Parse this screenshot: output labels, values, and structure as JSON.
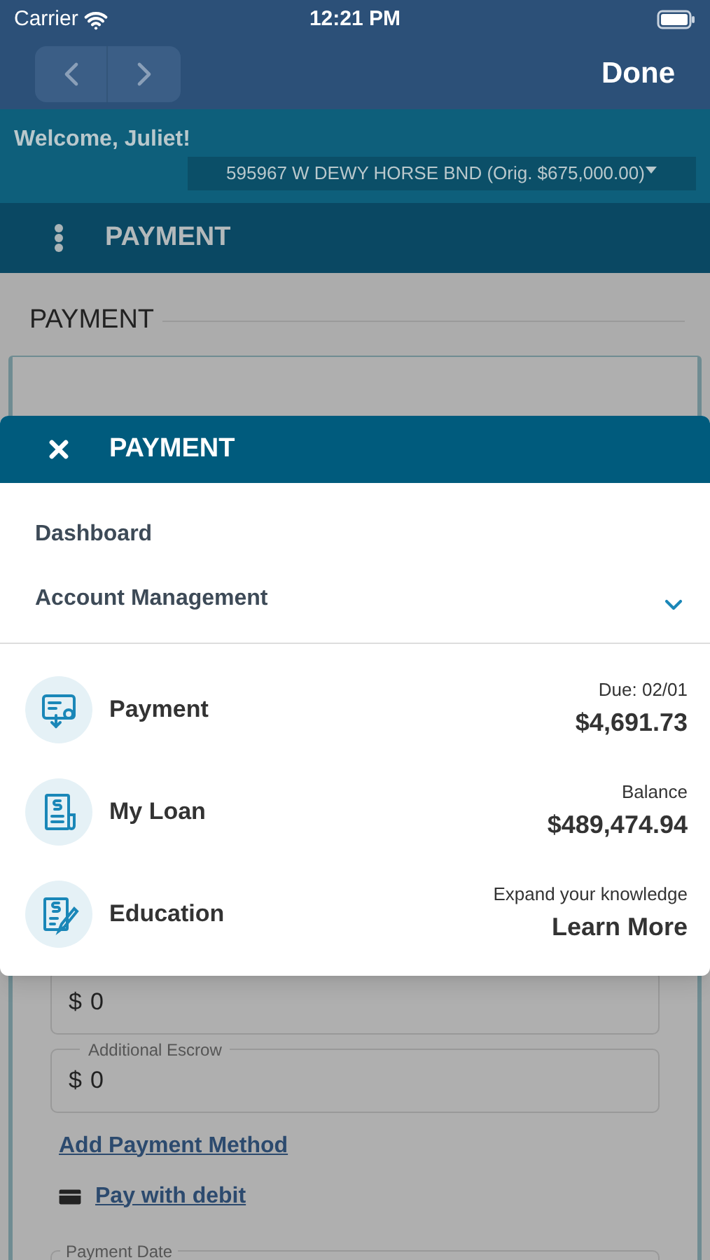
{
  "status_bar": {
    "carrier": "Carrier",
    "time": "12:21 PM"
  },
  "nav_bar": {
    "back_disabled": true,
    "forward_disabled": true,
    "done": "Done"
  },
  "welcome": "Welcome, Juliet!",
  "loan_select": {
    "value": "595967 W DEWY HORSE BND (Orig. $675,000.00)"
  },
  "section_header": {
    "title": "PAYMENT"
  },
  "page": {
    "heading": "PAYMENT",
    "fields": [
      {
        "value": "0",
        "prefix": "$"
      },
      {
        "label": "Additional Escrow",
        "value": "0",
        "prefix": "$"
      }
    ],
    "add_method_link": "Add Payment Method",
    "debit_link": "Pay with debit",
    "date_field": {
      "label": "Payment Date"
    }
  },
  "menu": {
    "title": "PAYMENT",
    "items": [
      {
        "kind": "link",
        "label": "Dashboard"
      },
      {
        "kind": "group",
        "label": "Account Management",
        "expanded": false
      }
    ],
    "quick_links": [
      {
        "kind": "payment",
        "title": "Payment",
        "caption": "Due: 02/01",
        "value": "$4,691.73"
      },
      {
        "kind": "loan",
        "title": "My Loan",
        "caption": "Balance",
        "value": "$489,474.94"
      },
      {
        "kind": "education",
        "title": "Education",
        "caption": "Expand your knowledge",
        "value": "Learn More"
      }
    ]
  }
}
